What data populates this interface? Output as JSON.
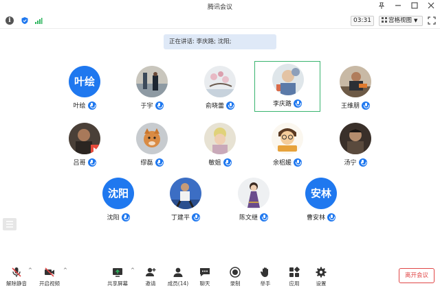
{
  "window": {
    "title": "腾讯会议"
  },
  "toolbar": {
    "timer": "03:31",
    "view_label": "宫格视图"
  },
  "banner": {
    "text": "正在讲话: 李庆路; 沈阳;"
  },
  "participants": [
    {
      "name": "叶绘",
      "avatar_text": "叶绘"
    },
    {
      "name": "于宇"
    },
    {
      "name": "俞晓蕾"
    },
    {
      "name": "李庆路"
    },
    {
      "name": "王维朋"
    },
    {
      "name": "吕哥"
    },
    {
      "name": "缪磊"
    },
    {
      "name": "敏姐"
    },
    {
      "name": "余梠媛"
    },
    {
      "name": "汤宁"
    },
    {
      "name": "沈阳",
      "avatar_text": "沈阳"
    },
    {
      "name": "丁建平"
    },
    {
      "name": "陈文继"
    },
    {
      "name": "曹安林",
      "avatar_text": "安林"
    }
  ],
  "bottombar": {
    "unmute": "解除静音",
    "start_video": "开启视频",
    "share_screen": "共享屏幕",
    "invite": "邀请",
    "members": "成员(14)",
    "chat": "聊天",
    "record": "录制",
    "raise_hand": "举手",
    "apps": "应用",
    "settings": "设置",
    "leave": "离开会议"
  },
  "colors": {
    "accent": "#1f78ef",
    "active_border": "#37b36d",
    "leave": "#e04545",
    "banner_bg": "#dfe9f7"
  }
}
